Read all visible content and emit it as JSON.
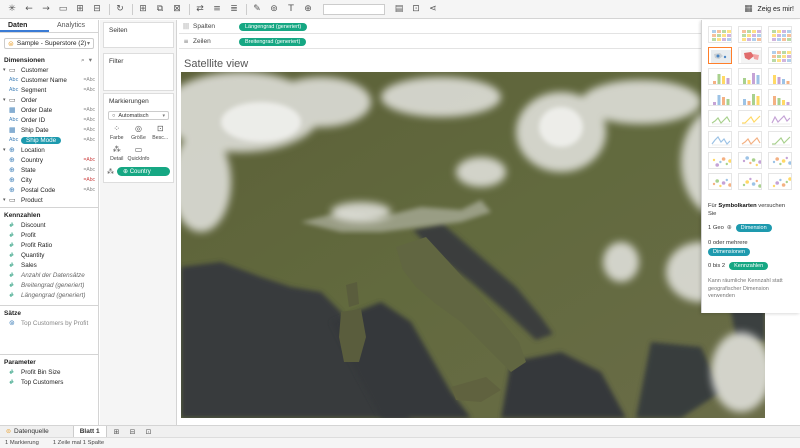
{
  "toolbar": {
    "icons": [
      "undo",
      "back",
      "forward",
      "save",
      "new-datasource",
      "duplicate",
      "clear",
      "swap",
      "sort",
      "group",
      "highlight",
      "label",
      "fix-axes",
      "fit",
      "show-cards",
      "presentation",
      "share"
    ],
    "show_me_label": "Zeig es mir!"
  },
  "data_pane": {
    "tabs": [
      "Daten",
      "Analytics"
    ],
    "datasource": "Sample - Superstore (2)",
    "dimensions_header": "Dimensionen",
    "dimensions": [
      {
        "label": "Customer",
        "type": "folder",
        "level": 0
      },
      {
        "label": "Customer Name",
        "type": "abc",
        "level": 1,
        "eq": "=Abc"
      },
      {
        "label": "Segment",
        "type": "abc",
        "level": 1,
        "eq": "=Abc"
      },
      {
        "label": "Order",
        "type": "folder",
        "level": 0
      },
      {
        "label": "Order Date",
        "type": "date",
        "level": 1,
        "eq": "=Abc"
      },
      {
        "label": "Order ID",
        "type": "abc",
        "level": 1,
        "eq": "=Abc"
      },
      {
        "label": "Ship Date",
        "type": "date",
        "level": 1,
        "eq": "=Abc"
      },
      {
        "label": "Ship Mode",
        "type": "abc",
        "level": 1,
        "eq": "=Abc",
        "selected": true
      },
      {
        "label": "Location",
        "type": "geo-folder",
        "level": 0
      },
      {
        "label": "Country",
        "type": "geo",
        "level": 1,
        "eq": "=Abc",
        "red": true
      },
      {
        "label": "State",
        "type": "geo",
        "level": 1,
        "eq": "=Abc"
      },
      {
        "label": "City",
        "type": "geo",
        "level": 1,
        "eq": "=Abc",
        "red": true
      },
      {
        "label": "Postal Code",
        "type": "geo",
        "level": 1,
        "eq": "=Abc"
      },
      {
        "label": "Product",
        "type": "folder",
        "level": 0
      }
    ],
    "measures_header": "Kennzahlen",
    "measures": [
      {
        "label": "Discount",
        "style": "normal"
      },
      {
        "label": "Profit",
        "style": "normal"
      },
      {
        "label": "Profit Ratio",
        "style": "normal"
      },
      {
        "label": "Quantity",
        "style": "normal"
      },
      {
        "label": "Sales",
        "style": "normal"
      },
      {
        "label": "Anzahl der Datensätze",
        "style": "italic"
      },
      {
        "label": "Breitengrad (generiert)",
        "style": "italic"
      },
      {
        "label": "Längengrad (generiert)",
        "style": "italic"
      }
    ],
    "sets_header": "Sätze",
    "sets": [
      {
        "label": "Top Customers by Profit"
      }
    ],
    "params_header": "Parameter",
    "params": [
      {
        "label": "Profit Bin Size"
      },
      {
        "label": "Top Customers"
      }
    ]
  },
  "cards": {
    "pages": "Seiten",
    "filters": "Filter",
    "marks": "Markierungen",
    "marks_type": "Automatisch",
    "mark_buttons": [
      "Farbe",
      "Größe",
      "Besc...",
      "Detail",
      "QuickInfo"
    ],
    "detail_field": "Country"
  },
  "shelves": {
    "columns_label": "Spalten",
    "columns_pill": "Längengrad (generiert)",
    "rows_label": "Zeilen",
    "rows_pill": "Breitengrad (generiert)"
  },
  "worksheet": {
    "title": "Satellite view"
  },
  "show_me": {
    "selected_index": 3,
    "hint_prefix": "Für",
    "hint_bold": "Symbolkarten",
    "hint_suffix": "versuchen Sie",
    "line1_prefix": "1 Geo",
    "line1_pill": "Dimension",
    "line2_prefix": "0 oder mehrere",
    "line2_pill": "Dimensionen",
    "line3_prefix": "0 bis 2",
    "line3_pill": "Kennzahlen",
    "note": "Kann räumliche Kennzahl statt geografischer Dimension verwenden"
  },
  "bottom": {
    "datasource_tab": "Datenquelle",
    "sheet_tab": "Blatt 1",
    "status": [
      "1 Markierung",
      "1 Zeile mal 1 Spalte"
    ]
  },
  "colors": {
    "accent_teal": "#1e9aae",
    "pill_green": "#16a783",
    "selected_border": "#ff7f2a"
  }
}
